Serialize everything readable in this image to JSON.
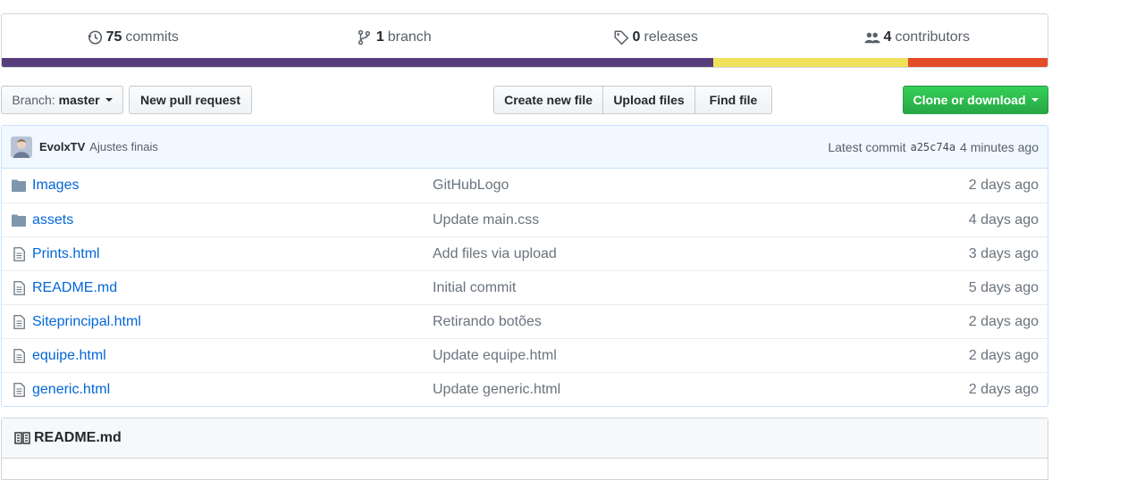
{
  "stats": {
    "commits": {
      "count": "75",
      "label": "commits",
      "icon": "history-icon"
    },
    "branches": {
      "count": "1",
      "label": "branch",
      "icon": "branch-icon"
    },
    "releases": {
      "count": "0",
      "label": "releases",
      "icon": "tag-icon"
    },
    "contributors": {
      "count": "4",
      "label": "contributors",
      "icon": "people-icon"
    }
  },
  "languages": [
    {
      "color": "#563d7c",
      "share": 0.68
    },
    {
      "color": "#f1e05a",
      "share": 0.187
    },
    {
      "color": "#e34c26",
      "share": 0.133
    }
  ],
  "toolbar": {
    "branch_prefix": "Branch:",
    "branch_name": "master",
    "new_pull_request": "New pull request",
    "create_new_file": "Create new file",
    "upload_files": "Upload files",
    "find_file": "Find file",
    "clone_or_download": "Clone or download"
  },
  "latest_commit": {
    "author": "EvolxTV",
    "message": "Ajustes finais",
    "label": "Latest commit",
    "sha": "a25c74a",
    "time": "4 minutes ago"
  },
  "files": [
    {
      "type": "folder",
      "name": "Images",
      "message": "GitHubLogo",
      "age": "2 days ago"
    },
    {
      "type": "folder",
      "name": "assets",
      "message": "Update main.css",
      "age": "4 days ago"
    },
    {
      "type": "file",
      "name": "Prints.html",
      "message": "Add files via upload",
      "age": "3 days ago"
    },
    {
      "type": "file",
      "name": "README.md",
      "message": "Initial commit",
      "age": "5 days ago"
    },
    {
      "type": "file",
      "name": "Siteprincipal.html",
      "message": "Retirando botões",
      "age": "2 days ago"
    },
    {
      "type": "file",
      "name": "equipe.html",
      "message": "Update equipe.html",
      "age": "2 days ago"
    },
    {
      "type": "file",
      "name": "generic.html",
      "message": "Update generic.html",
      "age": "2 days ago"
    }
  ],
  "readme": {
    "title": "README.md",
    "icon": "book-icon"
  }
}
